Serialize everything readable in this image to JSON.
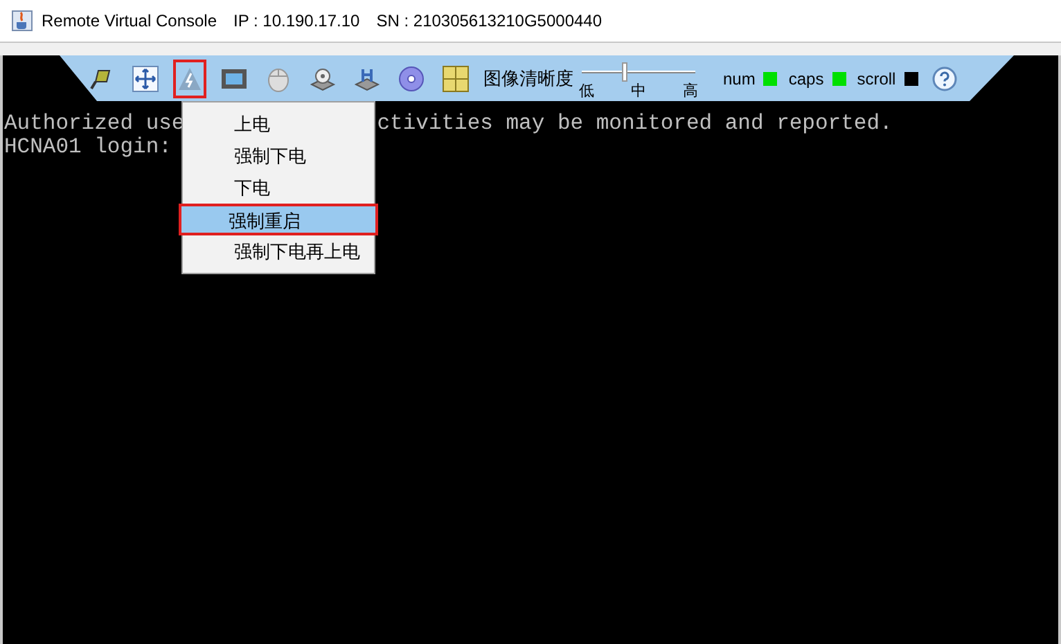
{
  "window": {
    "title": "Remote Virtual Console",
    "ip": "IP : 10.190.17.10",
    "sn": "SN : 210305613210G5000440"
  },
  "toolbar": {
    "tools": [
      {
        "kind": "connect",
        "selected": false
      },
      {
        "kind": "move",
        "selected": false
      },
      {
        "kind": "power",
        "selected": true
      },
      {
        "kind": "screen",
        "selected": false
      },
      {
        "kind": "mouse",
        "selected": false
      },
      {
        "kind": "drive",
        "selected": false
      },
      {
        "kind": "floppy",
        "selected": false
      },
      {
        "kind": "disc",
        "selected": false
      },
      {
        "kind": "keys",
        "selected": false
      }
    ],
    "quality": {
      "label": "图像清晰度",
      "level": 0.38,
      "ticks": [
        "低",
        "中",
        "高"
      ]
    },
    "indicators": [
      {
        "label": "num",
        "on": true
      },
      {
        "label": "caps",
        "on": true
      },
      {
        "label": "scroll",
        "on": false
      }
    ]
  },
  "console": {
    "lines": [
      [
        "Authorized use",
        "ctivities may be monitored and reported."
      ],
      [
        "HCNA01 login:"
      ]
    ]
  },
  "power_menu": [
    {
      "label": "上电",
      "selected": false
    },
    {
      "label": "强制下电",
      "selected": false
    },
    {
      "label": "下电",
      "selected": false
    },
    {
      "label": "强制重启",
      "selected": true
    },
    {
      "label": "强制下电再上电",
      "selected": false
    }
  ]
}
